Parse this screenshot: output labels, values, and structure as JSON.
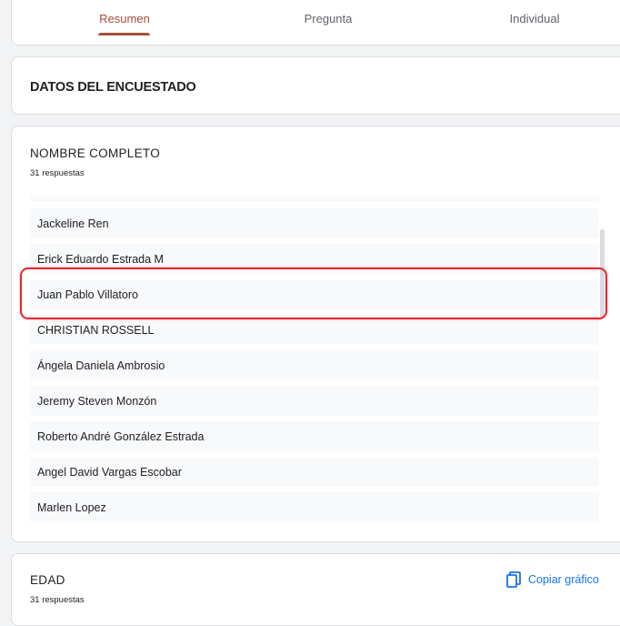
{
  "tabs": [
    {
      "label": "Resumen",
      "active": true
    },
    {
      "label": "Pregunta",
      "active": false
    },
    {
      "label": "Individual",
      "active": false
    }
  ],
  "section": {
    "title": "DATOS DEL ENCUESTADO"
  },
  "question": {
    "title": "NOMBRE COMPLETO",
    "count": "31 respuestas",
    "responses": [
      "Jackeline Ren",
      "Erick Eduardo Estrada M",
      "Juan Pablo Villatoro",
      "CHRISTIAN ROSSELL",
      "Ángela Daniela Ambrosio",
      "Jeremy Steven Monzón",
      "Roberto André González Estrada",
      "Angel David Vargas Escobar",
      "Marlen Lopez"
    ],
    "highlighted_response": "Juan Pablo Villatoro"
  },
  "edad": {
    "title": "EDAD",
    "count": "31 respuestas",
    "copy_label": "Copiar gráfico"
  },
  "colors": {
    "accent": "#a64d3a",
    "link": "#1a73e8",
    "highlight": "#e8262d"
  }
}
